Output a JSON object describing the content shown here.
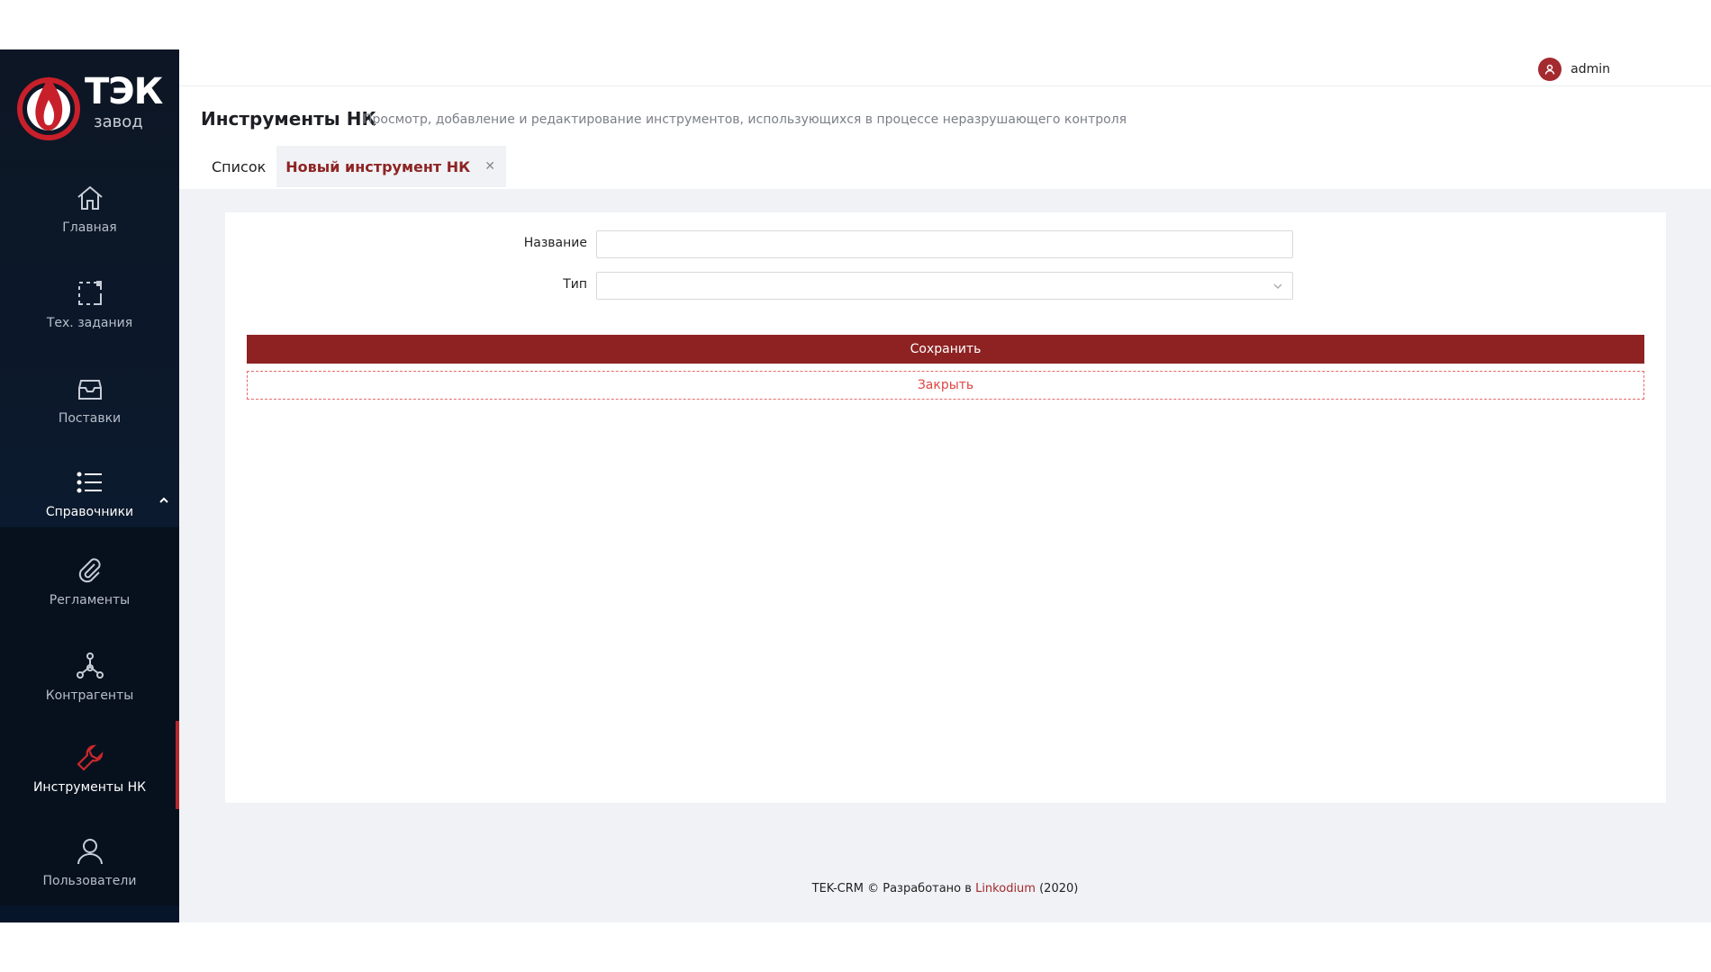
{
  "logo": {
    "word1": "ТЭК",
    "word2": "завод"
  },
  "sidebar": {
    "items": [
      {
        "label": "Главная",
        "icon": "home-icon"
      },
      {
        "label": "Тех. задания",
        "icon": "task-icon"
      },
      {
        "label": "Поставки",
        "icon": "inbox-icon"
      },
      {
        "label": "Справочники",
        "icon": "list-icon"
      },
      {
        "label": "Регламенты",
        "icon": "paperclip-icon"
      },
      {
        "label": "Контрагенты",
        "icon": "network-icon"
      },
      {
        "label": "Инструменты НК",
        "icon": "wrench-icon"
      },
      {
        "label": "Пользователи",
        "icon": "user-icon"
      }
    ]
  },
  "header": {
    "username": "admin"
  },
  "page": {
    "title": "Инструменты НК",
    "subtitle": "Просмотр, добавление и редактирование инструментов, использующихся в процессе неразрушающего контроля"
  },
  "tabs": [
    {
      "label": "Список"
    },
    {
      "label": "Новый инструмент НК"
    }
  ],
  "form": {
    "name_label": "Название",
    "name_value": "",
    "type_label": "Тип",
    "type_value": "",
    "save_label": "Сохранить",
    "close_label": "Закрыть"
  },
  "footer": {
    "text_before": "TEK-CRM © Разработано в ",
    "link": "Linkodium",
    "text_after": " (2020)"
  },
  "colors": {
    "accent": "#8e2222",
    "sidebar": "#0b1a2e",
    "close_text": "#e04545"
  }
}
